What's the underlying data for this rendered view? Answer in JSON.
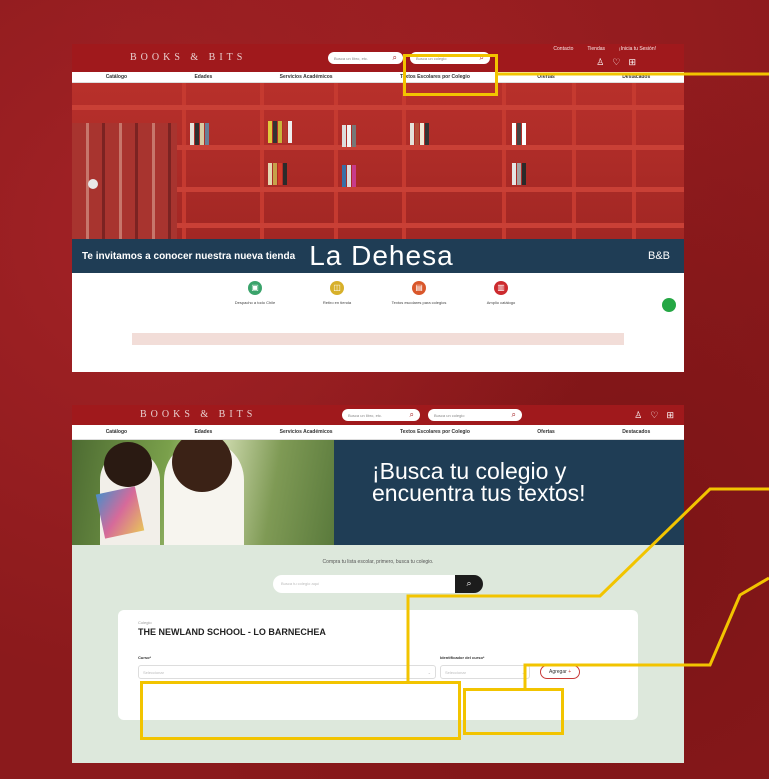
{
  "shot1": {
    "logo": "BOOKS & BITS",
    "toplinks": [
      "Contacto",
      "Tiendas",
      "¡Inicia tu Sesión!"
    ],
    "search_books_placeholder": "Busca un libro, etc.",
    "search_school_placeholder": "Busca un colegio",
    "nav": [
      "Catálogo",
      "Edades",
      "Servicios Académicos",
      "Textos Escolares por Colegio",
      "Ofertas",
      "Destacados"
    ],
    "banner_text": "Te invitamos a conocer nuestra nueva tienda",
    "banner_title": "La Dehesa",
    "banner_brand": "B&B",
    "services": [
      "Despacho a todo Chile",
      "Retiro en tienda",
      "Textos escolares para colegios",
      "Amplio catálogo"
    ],
    "colors": {
      "header": "#a0191c",
      "banner": "#1f3d55",
      "callout": "#f2c400"
    }
  },
  "shot2": {
    "logo": "BOOKS & BITS",
    "search_books_placeholder": "Busca un libro, etc.",
    "search_school_placeholder": "Busca un colegio",
    "nav": [
      "Catálogo",
      "Edades",
      "Servicios Académicos",
      "Textos Escolares por Colegio",
      "Ofertas",
      "Destacados"
    ],
    "hero_line1": "¡Busca tu colegio y",
    "hero_line2": "encuentra tus textos!",
    "instruction": "Compra tu lista escolar, primero, busca tu colegio.",
    "finder_placeholder": "Busca tu colegio aquí",
    "card": {
      "label": "Colegio",
      "school": "THE NEWLAND SCHOOL - LO BARNECHEA",
      "curso_label": "Curso*",
      "curso_placeholder": "Seleccionar",
      "id_label": "Identificador del curso*",
      "id_placeholder": "Seleccionar",
      "add_button": "Agregar"
    }
  }
}
